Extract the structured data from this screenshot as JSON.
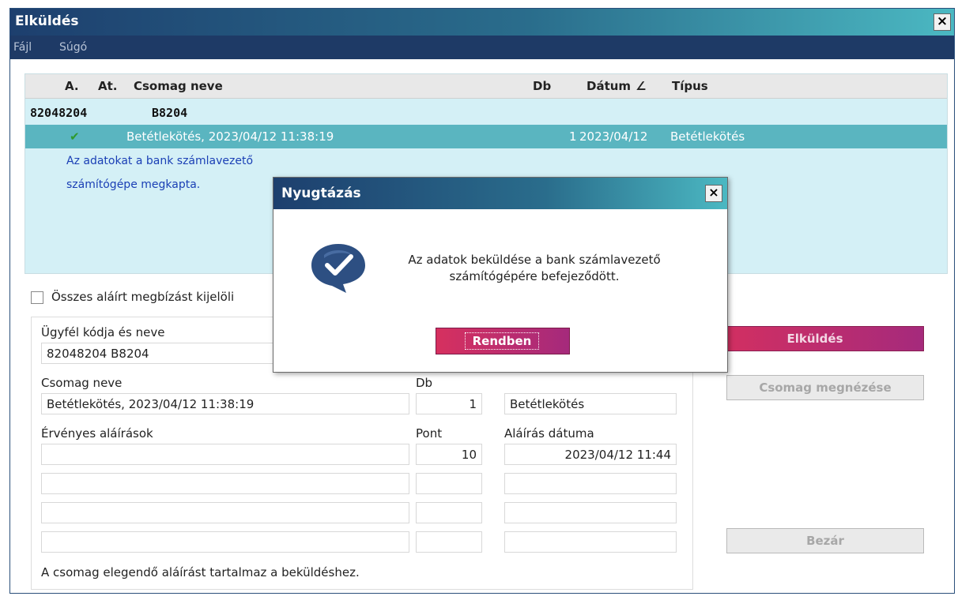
{
  "window": {
    "title": "Elküldés",
    "close_symbol": "×"
  },
  "menu": {
    "items": [
      "Fájl",
      "Súgó"
    ]
  },
  "grid": {
    "columns": [
      "A.",
      "At.",
      "Csomag neve",
      "Db",
      "Dátum",
      "Típus"
    ],
    "sort_indicator": "∠",
    "group": {
      "code": "82048204",
      "name": "B8204"
    },
    "selected_row": {
      "status_icon": "check-icon",
      "package_name": "Betétlekötés, 2023/04/12 11:38:19",
      "count": "1",
      "date": "2023/04/12",
      "type": "Betétlekötés"
    },
    "info_lines": [
      "Az adatokat a bank számlavezető",
      "számítógépe megkapta."
    ]
  },
  "select_all_label": "Összes aláírt megbízást kijelöli",
  "details": {
    "client_label": "Ügyfél kódja és neve",
    "client_value": "82048204  B8204",
    "package_label": "Csomag neve",
    "package_value": "Betétlekötés, 2023/04/12 11:38:19",
    "count_label": "Db",
    "count_value": "1",
    "type_value": "Betétlekötés",
    "signatures_label": "Érvényes aláírások",
    "points_label": "Pont",
    "sign_date_label": "Aláírás dátuma",
    "signatures": [
      {
        "name": "",
        "points": "10",
        "date": "2023/04/12 11:44"
      },
      {
        "name": "",
        "points": "",
        "date": ""
      },
      {
        "name": "",
        "points": "",
        "date": ""
      },
      {
        "name": "",
        "points": "",
        "date": ""
      }
    ],
    "status_text": "A csomag elegendő aláírást tartalmaz a beküldéshez."
  },
  "buttons": {
    "send": "Elküldés",
    "view_package": "Csomag megnézése",
    "close": "Bezár"
  },
  "dialog": {
    "title": "Nyugtázás",
    "close_symbol": "×",
    "icon": "chat-check-icon",
    "message_line1": "Az adatok beküldése a bank számlavezető",
    "message_line2": "számítógépére befejeződött.",
    "ok_label": "Rendben"
  },
  "colors": {
    "titlebar_start": "#1d3f6e",
    "titlebar_end": "#4bb8c2",
    "grid_background": "#d4f0f6",
    "selected_row": "#5ab5c0",
    "info_text": "#1a3fb5",
    "primary_button": "#d6305f",
    "check_green": "#2e9a2e"
  }
}
